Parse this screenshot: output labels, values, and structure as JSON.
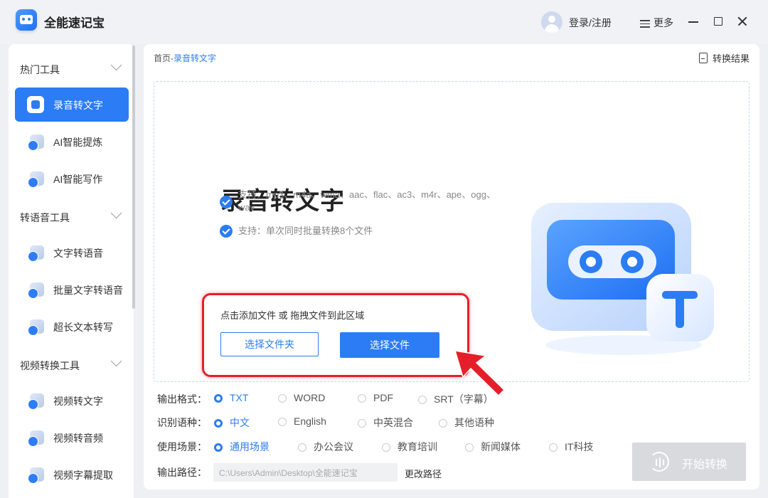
{
  "app": {
    "title": "全能速记宝"
  },
  "header": {
    "login": "登录/注册",
    "more": "更多"
  },
  "sidebar": {
    "groups": [
      {
        "label": "热门工具"
      },
      {
        "label": "转语音工具"
      },
      {
        "label": "视频转换工具"
      }
    ],
    "items": [
      {
        "label": "录音转文字",
        "active": true
      },
      {
        "label": "AI智能提炼"
      },
      {
        "label": "AI智能写作"
      },
      {
        "label": "文字转语音"
      },
      {
        "label": "批量文字转语音"
      },
      {
        "label": "超长文本转写"
      },
      {
        "label": "视频转文字"
      },
      {
        "label": "视频转音频"
      },
      {
        "label": "视频字幕提取"
      }
    ]
  },
  "breadcrumb": {
    "home": "首页",
    "sep": "-",
    "current": "录音转文字"
  },
  "result_button": "转换结果",
  "hero": {
    "title": "录音转文字",
    "support_formats": "支持：mp3、m4a、wma、aac、flac、ac3、m4r、ape、ogg、wav",
    "support_batch": "支持：单次同时批量转换8个文件",
    "hint": "点击添加文件 或 拖拽文件到此区域",
    "btn_folder": "选择文件夹",
    "btn_file": "选择文件"
  },
  "options": {
    "format": {
      "label": "输出格式：",
      "choices": [
        "TXT",
        "WORD",
        "PDF",
        "SRT（字幕）"
      ],
      "selected": "TXT"
    },
    "language": {
      "label": "识别语种：",
      "choices": [
        "中文",
        "English",
        "中英混合",
        "其他语种"
      ],
      "selected": "中文"
    },
    "scene": {
      "label": "使用场景：",
      "choices": [
        "通用场景",
        "办公会议",
        "教育培训",
        "新闻媒体",
        "IT科技"
      ],
      "selected": "通用场景"
    },
    "path": {
      "label": "输出路径：",
      "value": "C:\\Users\\Admin\\Desktop\\全能速记宝",
      "change": "更改路径"
    }
  },
  "start_button": "开始转换",
  "colors": {
    "accent": "#2b7cf5",
    "highlight": "#e51f2a",
    "disabled": "#d8dadd"
  }
}
